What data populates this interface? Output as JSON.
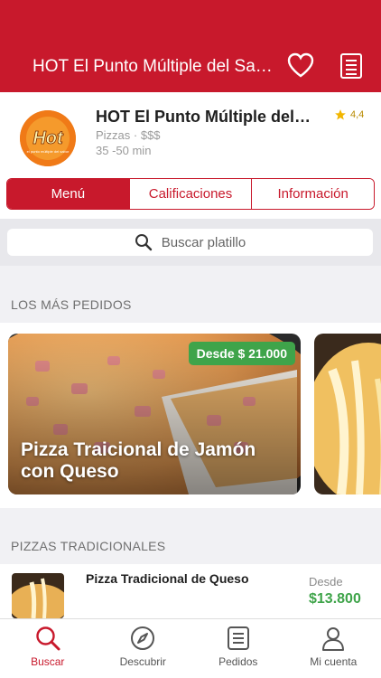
{
  "header": {
    "title": "HOT El Punto Múltiple del Sabor",
    "favorite_icon": "heart-icon",
    "menu_icon": "document-list-icon"
  },
  "restaurant": {
    "name": "HOT El Punto Múltiple del Sabor",
    "category": "Pizzas · $$$",
    "delivery_time": "35 -50 min",
    "rating": "4,4",
    "logo_text": "Hot",
    "logo_tagline": "el punto múltiple del sabor"
  },
  "tabs": [
    {
      "label": "Menú",
      "active": true
    },
    {
      "label": "Calificaciones",
      "active": false
    },
    {
      "label": "Información",
      "active": false
    }
  ],
  "search": {
    "placeholder": "Buscar platillo"
  },
  "sections": {
    "popular": "LOS MÁS PEDIDOS",
    "traditional": "PIZZAS TRADICIONALES"
  },
  "featured": [
    {
      "title": "Pizza Traicional de Jamón con Queso",
      "price": "Desde $ 21.000"
    }
  ],
  "list": [
    {
      "name": "Pizza Tradicional de Queso",
      "from": "Desde",
      "price": "$13.800"
    }
  ],
  "nav": [
    {
      "label": "Buscar",
      "icon": "search-icon",
      "active": true
    },
    {
      "label": "Descubrir",
      "icon": "compass-icon",
      "active": false
    },
    {
      "label": "Pedidos",
      "icon": "orders-icon",
      "active": false
    },
    {
      "label": "Mi cuenta",
      "icon": "user-icon",
      "active": false
    }
  ],
  "colors": {
    "brand": "#c8192c",
    "price_green": "#3fa44a",
    "rating_star": "#f2b600"
  }
}
